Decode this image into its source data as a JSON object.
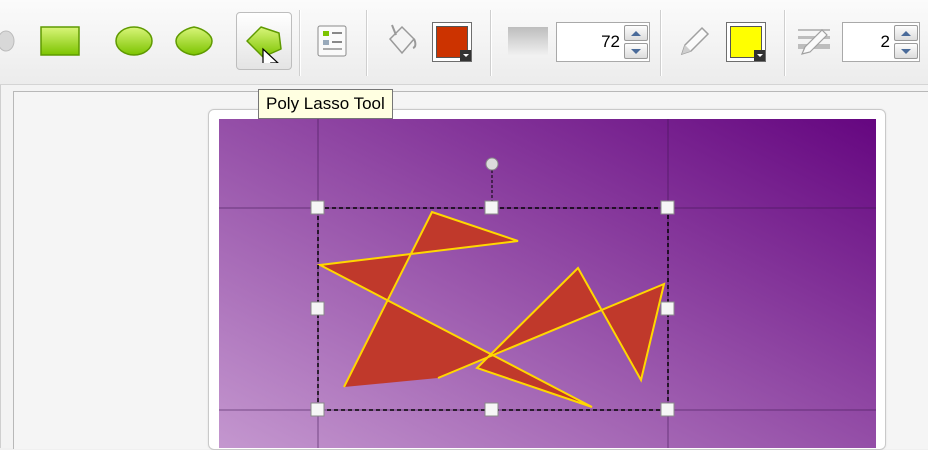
{
  "toolbar": {
    "tools": [
      {
        "name": "rectangle-tool",
        "icon": "rectangle-icon"
      },
      {
        "name": "ellipse-tool",
        "icon": "ellipse-icon"
      },
      {
        "name": "rounded-shape-tool",
        "icon": "rounded-diamond-icon"
      },
      {
        "name": "poly-lasso-tool",
        "icon": "polygon-icon",
        "selected": true
      }
    ],
    "properties_icon": "properties-icon",
    "fill_icon": "paint-bucket-icon",
    "fill_color": "#cc3300",
    "opacity_icon": "opacity-icon",
    "opacity_value": "72",
    "stroke_icon": "pencil-icon",
    "stroke_color": "#ffff00",
    "stroke_width_icon": "line-width-icon",
    "stroke_width_value": "2"
  },
  "tooltip": {
    "text": "Poly Lasso Tool"
  },
  "canvas": {
    "background_gradient": [
      "#c497cf",
      "#650680"
    ],
    "shape": {
      "fill": "#c0392b",
      "stroke": "#ffd700"
    }
  }
}
